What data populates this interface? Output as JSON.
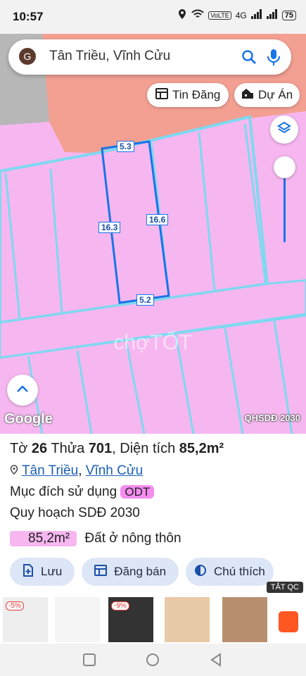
{
  "status_bar": {
    "time": "10:57",
    "network": "VoLTE",
    "signal": "4G",
    "battery": "75"
  },
  "search": {
    "avatar_letter": "G",
    "query": "Tân Triều, Vĩnh Cửu"
  },
  "chips": {
    "listings": "Tin Đăng",
    "projects": "Dự Án"
  },
  "map": {
    "dimensions": {
      "top": "5.3",
      "left": "16.3",
      "right": "16.6",
      "bottom": "5.2"
    },
    "google_logo": "Google",
    "layer_name": "QHSDĐ 2030",
    "watermark": "chợTỐT",
    "colors": {
      "parcel": "#f6b7f0",
      "road": "#7fd8f0",
      "water": "#f3a092",
      "selected": "#1a73e8"
    }
  },
  "parcel": {
    "sheet_label": "Tờ",
    "sheet": "26",
    "plot_label": "Thửa",
    "plot": "701",
    "area_label": "Diện tích",
    "area": "85,2m²",
    "ward": "Tân Triều",
    "district": "Vĩnh Cửu",
    "purpose_label": "Mục đích sử dụng",
    "purpose_code": "ODT",
    "plan_label": "Quy hoạch SDĐ 2030",
    "plan_area": "85,2m²",
    "plan_type": "Đất ở nông thôn"
  },
  "actions": {
    "save": "Lưu",
    "post": "Đăng bán",
    "legend": "Chú thích"
  },
  "ad_close": "TẮT QC",
  "ads": [
    {
      "badge": "-5%",
      "color": "#eeeeee"
    },
    {
      "badge": "",
      "color": "#f5f5f5"
    },
    {
      "badge": "-9%",
      "color": "#333333"
    },
    {
      "badge": "",
      "color": "#e8c9a8"
    },
    {
      "badge": "",
      "color": "#b89070"
    },
    {
      "badge": "",
      "color": "#ff5722"
    }
  ]
}
